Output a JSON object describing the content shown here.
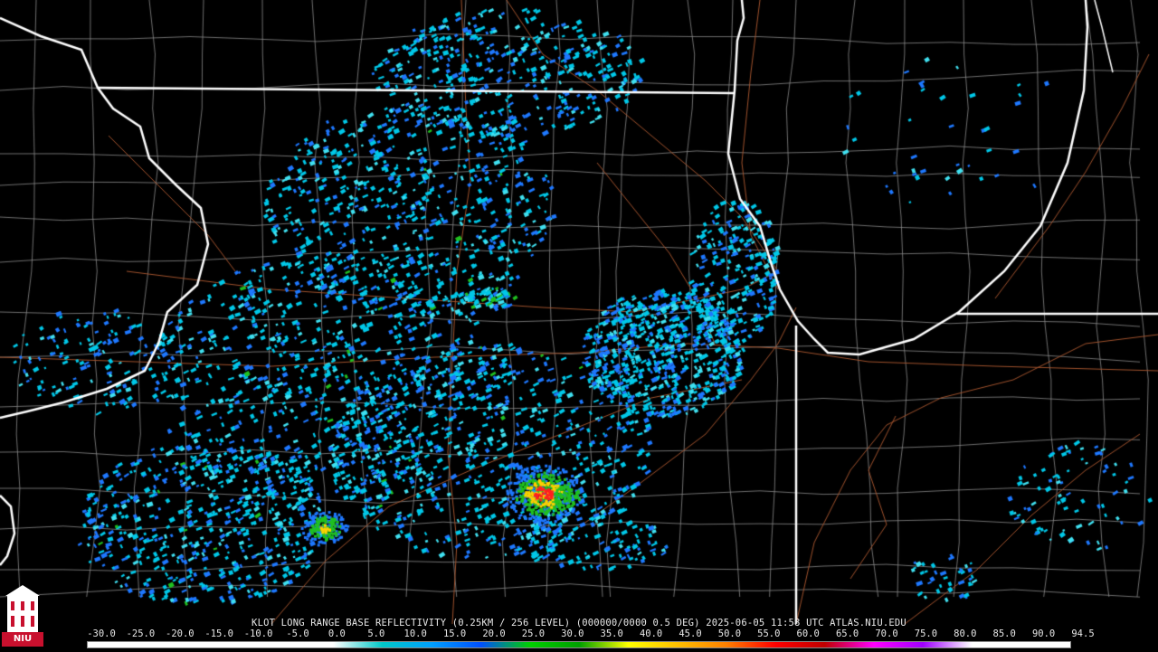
{
  "product": {
    "caption": "KLOT LONG RANGE BASE REFLECTIVITY (0.25KM / 256 LEVEL) (000000/0000 0.5 DEG) 2025-06-05 11:58 UTC  ATLAS.NIU.EDU"
  },
  "legend": {
    "ticks": [
      "-30.0",
      "-25.0",
      "-20.0",
      "-15.0",
      "-10.0",
      "-5.0",
      "0.0",
      "5.0",
      "10.0",
      "15.0",
      "20.0",
      "25.0",
      "30.0",
      "35.0",
      "40.0",
      "45.0",
      "50.0",
      "55.0",
      "60.0",
      "65.0",
      "70.0",
      "75.0",
      "80.0",
      "85.0",
      "90.0",
      "94.5"
    ],
    "colors": [
      "#ffffff",
      "#ffffff",
      "#ffffff",
      "#ffffff",
      "#ffffff",
      "#ffffff",
      "#00c8c8",
      "#00a0ff",
      "#0050ff",
      "#00d000",
      "#00a000",
      "#ffff00",
      "#ffc000",
      "#ff8000",
      "#ff0000",
      "#c00000",
      "#ff00ff",
      "#a000ff",
      "#ffffff",
      "#ffffff",
      "#ffffff"
    ]
  },
  "logo": {
    "text": "NIU"
  },
  "colors": {
    "background": "#000000",
    "state_border": "#ffffff",
    "county_border": "#8a8a8a",
    "highway": "#a0522d",
    "echo_light": "#00c8e8",
    "echo_moderate": "#1e78ff",
    "echo_green": "#20c020",
    "echo_yellow": "#ffd000",
    "echo_red": "#ff2020"
  }
}
